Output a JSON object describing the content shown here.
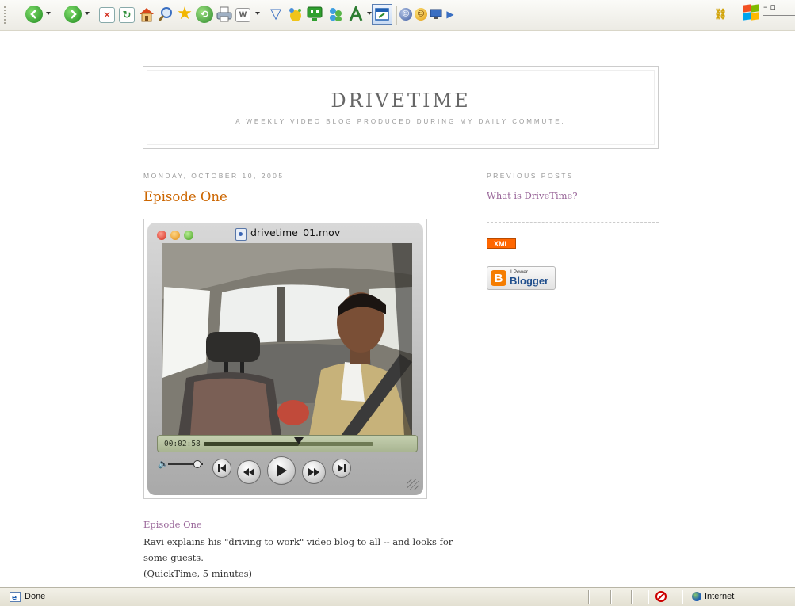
{
  "toolbar": {
    "buttons": [
      {
        "name": "back",
        "icon": "back-arrow-icon",
        "color": "#2d9a2d"
      },
      {
        "name": "forward",
        "icon": "forward-arrow-icon",
        "color": "#2d9a2d"
      },
      {
        "name": "stop",
        "icon": "stop-icon",
        "color": "#d12a1a"
      },
      {
        "name": "refresh",
        "icon": "refresh-icon",
        "color": "#2f8f3a"
      },
      {
        "name": "home",
        "icon": "home-icon",
        "color": "#e07b1c"
      },
      {
        "name": "search",
        "icon": "search-icon",
        "color": "#3a6fc2"
      },
      {
        "name": "favorites",
        "icon": "favorites-star-icon",
        "color": "#f2b600"
      },
      {
        "name": "history",
        "icon": "history-icon",
        "color": "#4a9a3a"
      },
      {
        "name": "print",
        "icon": "print-icon",
        "color": "#6d7c8f"
      },
      {
        "name": "edit",
        "icon": "edit-word-icon",
        "color": "#7a7a7a"
      }
    ]
  },
  "player": {
    "filename": "drivetime_01.mov",
    "time": "00:02:58",
    "progress": 0.56,
    "volume": 0.85
  },
  "blog": {
    "title": "DRIVETIME",
    "description": "A WEEKLY VIDEO BLOG PRODUCED DURING MY DAILY COMMUTE.",
    "date_header": "MONDAY, OCTOBER 10, 2005",
    "post_title": "Episode One",
    "caption_title": "Episode One",
    "caption_line1": "Ravi explains his \"driving to work\" video blog to all -- and looks for some guests.",
    "caption_line2": "(QuickTime, 5 minutes)"
  },
  "sidebar": {
    "heading": "PREVIOUS POSTS",
    "links": [
      "What is DriveTime?"
    ],
    "xml_badge": "XML",
    "blogger_small": "I Power",
    "blogger_big": "Blogger"
  },
  "status": {
    "text": "Done",
    "zone": "Internet"
  },
  "colors": {
    "accent": "#cc6600",
    "link": "#996699"
  }
}
